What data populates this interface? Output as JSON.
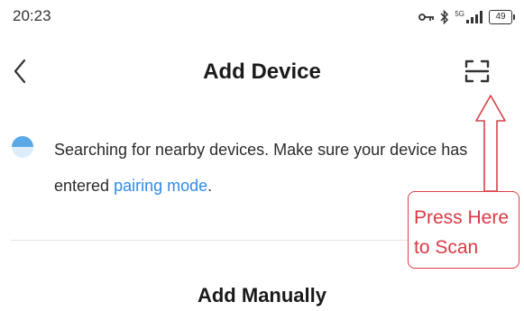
{
  "status_bar": {
    "time": "20:23",
    "signal_label": "5G",
    "battery_level": "49"
  },
  "header": {
    "title": "Add Device",
    "back_icon": "chevron-left-icon",
    "scan_icon": "scan-frame-icon"
  },
  "search": {
    "message_prefix": "Searching for nearby devices. Make sure your device has entered ",
    "link_text": "pairing mode",
    "message_suffix": ".",
    "spinner_icon": "loading-spinner-icon"
  },
  "annotation": {
    "line1": "Press Here",
    "line2": "to Scan",
    "color": "#d93a45"
  },
  "manual_section": {
    "title": "Add Manually"
  },
  "colors": {
    "link": "#2d8be8",
    "spinner": "#5aa9e6",
    "annotation": "#d93a45"
  }
}
